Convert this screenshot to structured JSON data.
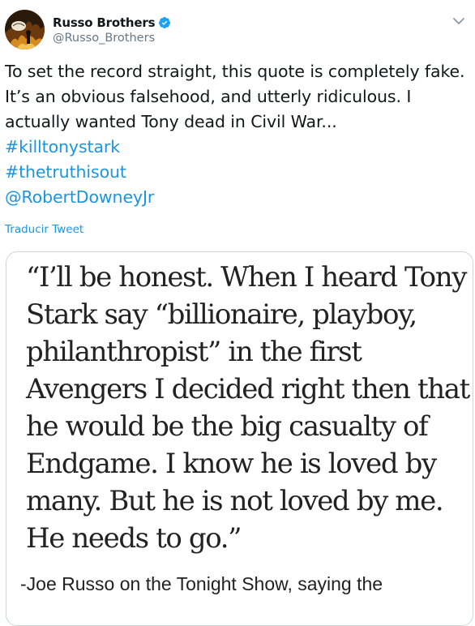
{
  "account": {
    "display_name": "Russo Brothers",
    "handle": "@Russo_Brothers",
    "avatar_icon": "avatar-image",
    "verified_icon": "verified-badge-icon",
    "menu_icon": "chevron-down-icon"
  },
  "tweet": {
    "lines": [
      "To set the record straight, this quote is completely fake.",
      "It’s an obvious falsehood, and utterly ridiculous. I",
      "actually wanted Tony dead in Civil War..."
    ],
    "hashtags": [
      "#killtonystark",
      "#thetruthisout"
    ],
    "mention": "@RobertDowneyJr",
    "translate_label": "Traducir Tweet"
  },
  "media": {
    "quote_lines": [
      "“I’ll be honest. When I heard Tony",
      "Stark say “billionaire, playboy,",
      "philanthropist” in the first",
      "Avengers I decided right then that",
      "he would be the big casualty of",
      "Endgame. I know he is loved by",
      "many. But he is not loved by me.",
      "He needs to go.”"
    ],
    "caption": "-Joe Russo on the Tonight Show, saying the"
  },
  "colors": {
    "link": "#1b95e0",
    "secondary_text": "#657786",
    "primary_text": "#14171a",
    "border": "#ccd6dd"
  }
}
